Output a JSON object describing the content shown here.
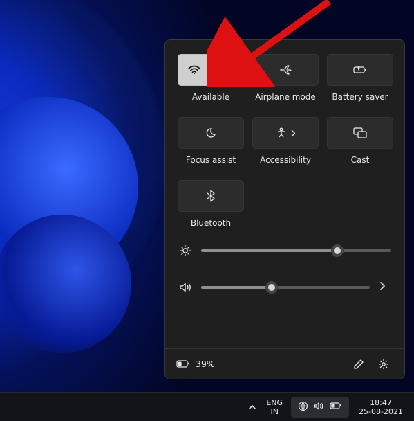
{
  "tiles": {
    "wifi": {
      "label": "Available"
    },
    "airplane": {
      "label": "Airplane mode"
    },
    "battery_saver": {
      "label": "Battery saver"
    },
    "focus_assist": {
      "label": "Focus assist"
    },
    "accessibility": {
      "label": "Accessibility"
    },
    "cast": {
      "label": "Cast"
    },
    "bluetooth": {
      "label": "Bluetooth"
    }
  },
  "sliders": {
    "brightness": {
      "percent": 72
    },
    "volume": {
      "percent": 42
    }
  },
  "footer": {
    "battery": "39%"
  },
  "taskbar": {
    "lang_top": "ENG",
    "lang_bottom": "IN",
    "time": "18:47",
    "date": "25-08-2021"
  }
}
